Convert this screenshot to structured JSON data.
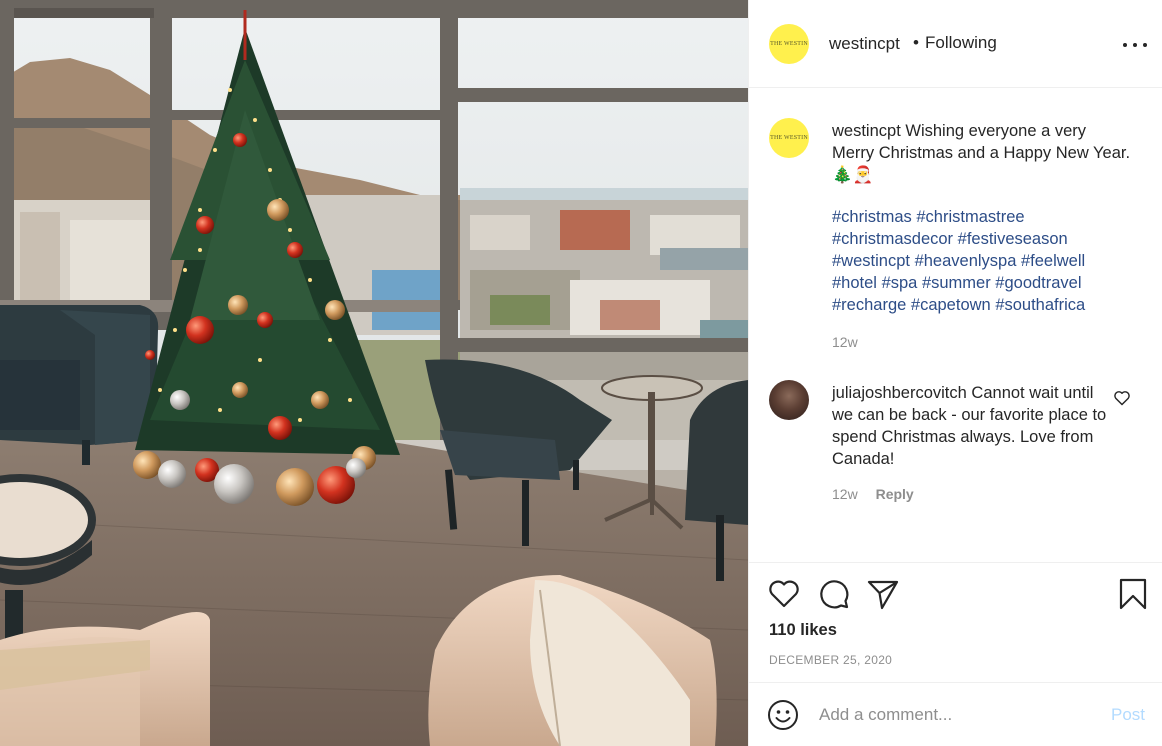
{
  "header": {
    "avatar_logo": "THE WESTIN",
    "username": "westincpt",
    "separator": "•",
    "follow_status": "Following"
  },
  "caption": {
    "avatar_logo": "THE WESTIN",
    "username": "westincpt",
    "text": "Wishing everyone a very Merry Christmas and a Happy New Year. 🎄🎅",
    "hashtags": [
      "#christmas",
      "#christmastree",
      "#christmasdecor",
      "#festiveseason",
      "#westincpt",
      "#heavenlyspa",
      "#feelwell",
      "#hotel",
      "#spa",
      "#summer",
      "#goodtravel",
      "#recharge",
      "#capetown",
      "#southafrica"
    ],
    "time": "12w"
  },
  "comment": {
    "username": "juliajoshbercovitch",
    "text": "Cannot wait until we can be back - our favorite place to spend Christmas always. Love from Canada!",
    "time": "12w",
    "reply_label": "Reply"
  },
  "actions": {
    "likes": "110 likes",
    "date": "DECEMBER 25, 2020"
  },
  "add_comment": {
    "placeholder": "Add a comment...",
    "post_label": "Post"
  },
  "icons": {
    "like": "heart-icon",
    "comment": "comment-icon",
    "share": "share-icon",
    "save": "bookmark-icon",
    "emoji": "emoji-icon",
    "more": "more-options-icon"
  },
  "colors": {
    "avatar_yellow": "#fff04d",
    "hashtag": "#2d4d87",
    "muted": "#8e8e8e",
    "post_disabled": "#b3dbff"
  }
}
